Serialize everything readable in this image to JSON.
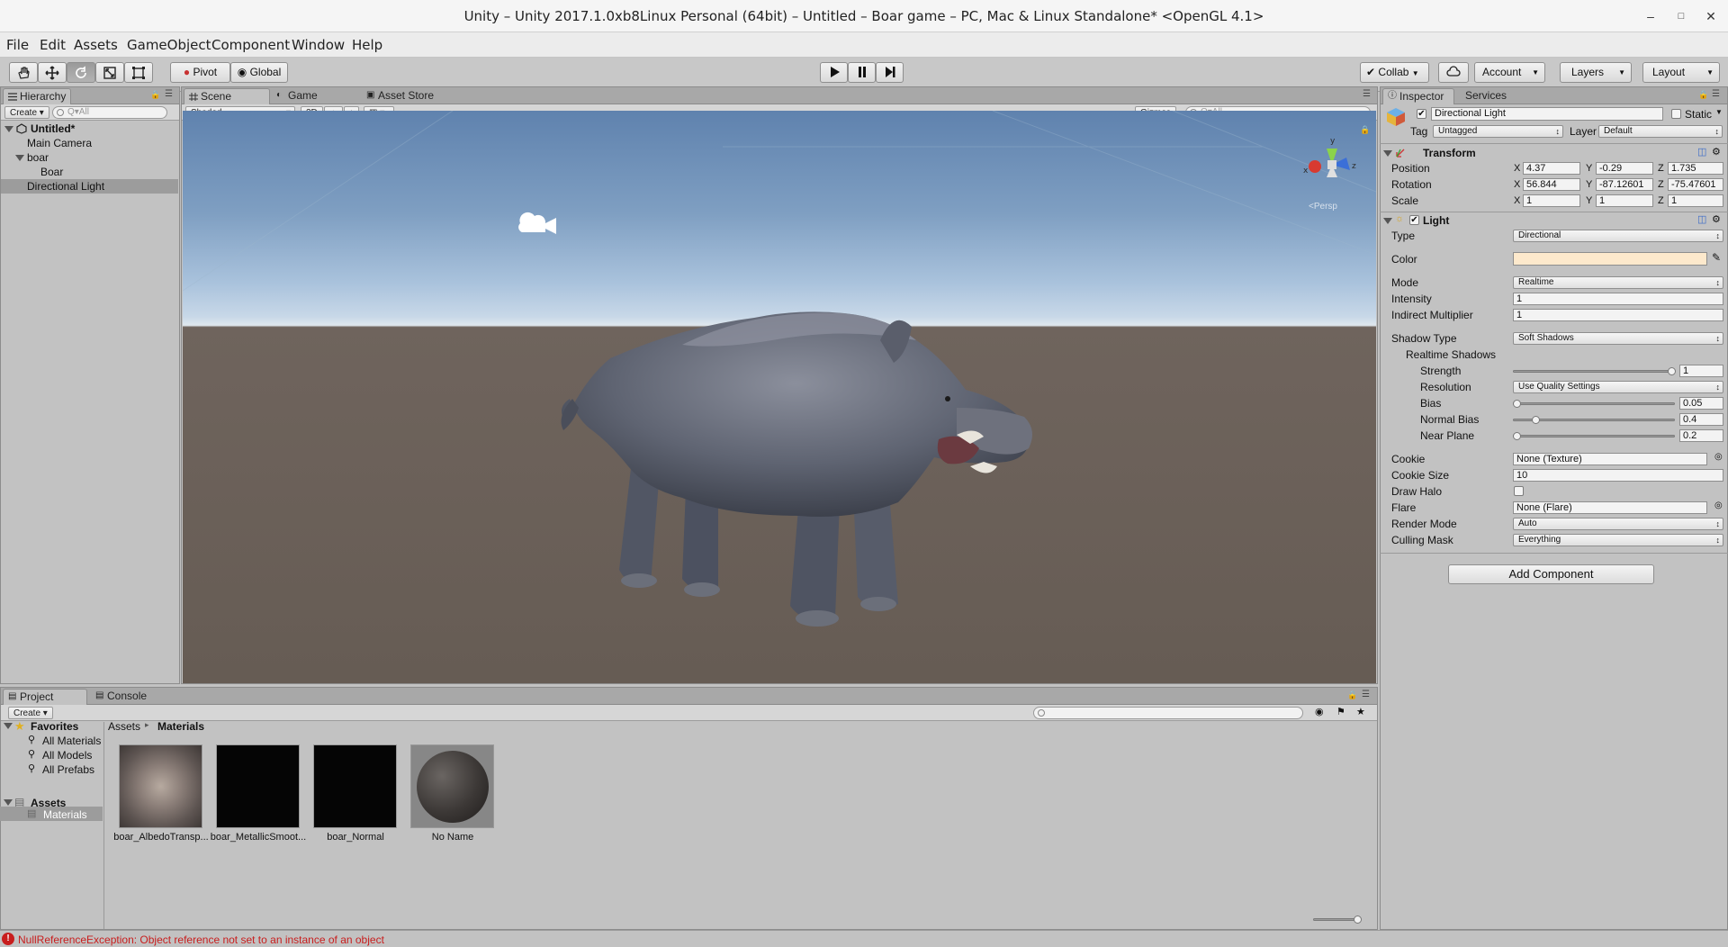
{
  "window": {
    "title": "Unity – Unity 2017.1.0xb8Linux Personal (64bit) – Untitled – Boar game – PC, Mac & Linux Standalone* <OpenGL 4.1>"
  },
  "menubar": [
    "File",
    "Edit",
    "Assets",
    "GameObject",
    "Component",
    "Window",
    "Help"
  ],
  "toolbar": {
    "pivot": "Pivot",
    "global": "Global",
    "collab": "Collab",
    "account": "Account",
    "layers": "Layers",
    "layout": "Layout"
  },
  "hierarchy": {
    "tab": "Hierarchy",
    "create": "Create",
    "search_placeholder": "Q▾All",
    "scene": "Untitled*",
    "items": [
      "Main Camera",
      "boar",
      "Boar",
      "Directional Light"
    ]
  },
  "scene": {
    "tabs": [
      "Scene",
      "Game",
      "Asset Store"
    ],
    "shading": "Shaded",
    "mode_2d": "2D",
    "gizmos": "Gizmos",
    "search_placeholder": "Q▾All",
    "persp": "<Persp",
    "gizmo_axes": {
      "x": "x",
      "y": "y",
      "z": "z"
    }
  },
  "inspector": {
    "tabs": [
      "Inspector",
      "Services"
    ],
    "object_name": "Directional Light",
    "static_label": "Static",
    "tag_label": "Tag",
    "tag_value": "Untagged",
    "layer_label": "Layer",
    "layer_value": "Default",
    "transform": {
      "title": "Transform",
      "position_label": "Position",
      "rotation_label": "Rotation",
      "scale_label": "Scale",
      "position": {
        "x": "4.37",
        "y": "-0.29",
        "z": "1.735"
      },
      "rotation": {
        "x": "56.844",
        "y": "-87.12601",
        "z": "-75.47601"
      },
      "scale": {
        "x": "1",
        "y": "1",
        "z": "1"
      }
    },
    "light": {
      "title": "Light",
      "type_label": "Type",
      "type_value": "Directional",
      "color_label": "Color",
      "color_value": "#fde9cc",
      "mode_label": "Mode",
      "mode_value": "Realtime",
      "intensity_label": "Intensity",
      "intensity_value": "1",
      "indirect_label": "Indirect Multiplier",
      "indirect_value": "1",
      "shadow_type_label": "Shadow Type",
      "shadow_type_value": "Soft Shadows",
      "realtime_shadows_label": "Realtime Shadows",
      "strength_label": "Strength",
      "strength_value": "1",
      "strength_fraction": 1.0,
      "resolution_label": "Resolution",
      "resolution_value": "Use Quality Settings",
      "bias_label": "Bias",
      "bias_value": "0.05",
      "bias_fraction": 0.0,
      "normal_bias_label": "Normal Bias",
      "normal_bias_value": "0.4",
      "normal_bias_fraction": 0.12,
      "near_plane_label": "Near Plane",
      "near_plane_value": "0.2",
      "near_plane_fraction": 0.0,
      "cookie_label": "Cookie",
      "cookie_value": "None (Texture)",
      "cookie_size_label": "Cookie Size",
      "cookie_size_value": "10",
      "draw_halo_label": "Draw Halo",
      "flare_label": "Flare",
      "flare_value": "None (Flare)",
      "render_mode_label": "Render Mode",
      "render_mode_value": "Auto",
      "culling_mask_label": "Culling Mask",
      "culling_mask_value": "Everything"
    },
    "add_component": "Add Component"
  },
  "project": {
    "tabs": [
      "Project",
      "Console"
    ],
    "create": "Create",
    "favorites_label": "Favorites",
    "favorites": [
      "All Materials",
      "All Models",
      "All Prefabs"
    ],
    "assets_label": "Assets",
    "folders": [
      "Materials"
    ],
    "breadcrumb": [
      "Assets",
      "Materials"
    ],
    "assets": [
      "boar_AlbedoTransp...",
      "boar_MetallicSmoot...",
      "boar_Normal",
      "No Name"
    ]
  },
  "status": {
    "message": "NullReferenceException: Object reference not set to an instance of an object"
  },
  "colors": {
    "error": "#c81e1e",
    "selection": "#9c9c9c",
    "sky": "#7f9fc2",
    "ground": "#665c54"
  }
}
